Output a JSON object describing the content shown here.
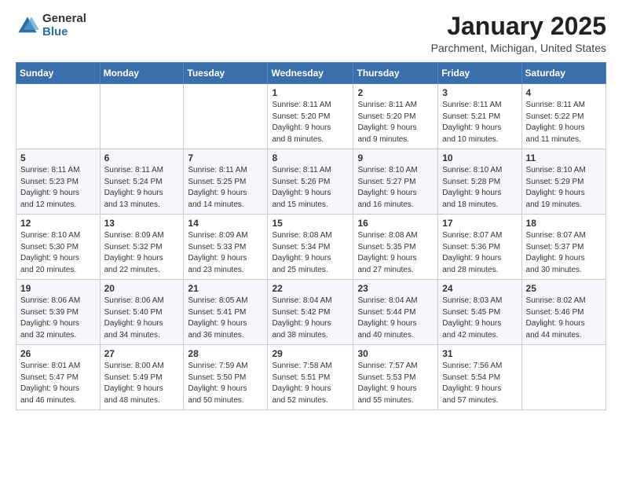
{
  "header": {
    "logo_general": "General",
    "logo_blue": "Blue",
    "month_title": "January 2025",
    "location": "Parchment, Michigan, United States"
  },
  "days_of_week": [
    "Sunday",
    "Monday",
    "Tuesday",
    "Wednesday",
    "Thursday",
    "Friday",
    "Saturday"
  ],
  "weeks": [
    [
      {
        "day": "",
        "info": ""
      },
      {
        "day": "",
        "info": ""
      },
      {
        "day": "",
        "info": ""
      },
      {
        "day": "1",
        "info": "Sunrise: 8:11 AM\nSunset: 5:20 PM\nDaylight: 9 hours\nand 8 minutes."
      },
      {
        "day": "2",
        "info": "Sunrise: 8:11 AM\nSunset: 5:20 PM\nDaylight: 9 hours\nand 9 minutes."
      },
      {
        "day": "3",
        "info": "Sunrise: 8:11 AM\nSunset: 5:21 PM\nDaylight: 9 hours\nand 10 minutes."
      },
      {
        "day": "4",
        "info": "Sunrise: 8:11 AM\nSunset: 5:22 PM\nDaylight: 9 hours\nand 11 minutes."
      }
    ],
    [
      {
        "day": "5",
        "info": "Sunrise: 8:11 AM\nSunset: 5:23 PM\nDaylight: 9 hours\nand 12 minutes."
      },
      {
        "day": "6",
        "info": "Sunrise: 8:11 AM\nSunset: 5:24 PM\nDaylight: 9 hours\nand 13 minutes."
      },
      {
        "day": "7",
        "info": "Sunrise: 8:11 AM\nSunset: 5:25 PM\nDaylight: 9 hours\nand 14 minutes."
      },
      {
        "day": "8",
        "info": "Sunrise: 8:11 AM\nSunset: 5:26 PM\nDaylight: 9 hours\nand 15 minutes."
      },
      {
        "day": "9",
        "info": "Sunrise: 8:10 AM\nSunset: 5:27 PM\nDaylight: 9 hours\nand 16 minutes."
      },
      {
        "day": "10",
        "info": "Sunrise: 8:10 AM\nSunset: 5:28 PM\nDaylight: 9 hours\nand 18 minutes."
      },
      {
        "day": "11",
        "info": "Sunrise: 8:10 AM\nSunset: 5:29 PM\nDaylight: 9 hours\nand 19 minutes."
      }
    ],
    [
      {
        "day": "12",
        "info": "Sunrise: 8:10 AM\nSunset: 5:30 PM\nDaylight: 9 hours\nand 20 minutes."
      },
      {
        "day": "13",
        "info": "Sunrise: 8:09 AM\nSunset: 5:32 PM\nDaylight: 9 hours\nand 22 minutes."
      },
      {
        "day": "14",
        "info": "Sunrise: 8:09 AM\nSunset: 5:33 PM\nDaylight: 9 hours\nand 23 minutes."
      },
      {
        "day": "15",
        "info": "Sunrise: 8:08 AM\nSunset: 5:34 PM\nDaylight: 9 hours\nand 25 minutes."
      },
      {
        "day": "16",
        "info": "Sunrise: 8:08 AM\nSunset: 5:35 PM\nDaylight: 9 hours\nand 27 minutes."
      },
      {
        "day": "17",
        "info": "Sunrise: 8:07 AM\nSunset: 5:36 PM\nDaylight: 9 hours\nand 28 minutes."
      },
      {
        "day": "18",
        "info": "Sunrise: 8:07 AM\nSunset: 5:37 PM\nDaylight: 9 hours\nand 30 minutes."
      }
    ],
    [
      {
        "day": "19",
        "info": "Sunrise: 8:06 AM\nSunset: 5:39 PM\nDaylight: 9 hours\nand 32 minutes."
      },
      {
        "day": "20",
        "info": "Sunrise: 8:06 AM\nSunset: 5:40 PM\nDaylight: 9 hours\nand 34 minutes."
      },
      {
        "day": "21",
        "info": "Sunrise: 8:05 AM\nSunset: 5:41 PM\nDaylight: 9 hours\nand 36 minutes."
      },
      {
        "day": "22",
        "info": "Sunrise: 8:04 AM\nSunset: 5:42 PM\nDaylight: 9 hours\nand 38 minutes."
      },
      {
        "day": "23",
        "info": "Sunrise: 8:04 AM\nSunset: 5:44 PM\nDaylight: 9 hours\nand 40 minutes."
      },
      {
        "day": "24",
        "info": "Sunrise: 8:03 AM\nSunset: 5:45 PM\nDaylight: 9 hours\nand 42 minutes."
      },
      {
        "day": "25",
        "info": "Sunrise: 8:02 AM\nSunset: 5:46 PM\nDaylight: 9 hours\nand 44 minutes."
      }
    ],
    [
      {
        "day": "26",
        "info": "Sunrise: 8:01 AM\nSunset: 5:47 PM\nDaylight: 9 hours\nand 46 minutes."
      },
      {
        "day": "27",
        "info": "Sunrise: 8:00 AM\nSunset: 5:49 PM\nDaylight: 9 hours\nand 48 minutes."
      },
      {
        "day": "28",
        "info": "Sunrise: 7:59 AM\nSunset: 5:50 PM\nDaylight: 9 hours\nand 50 minutes."
      },
      {
        "day": "29",
        "info": "Sunrise: 7:58 AM\nSunset: 5:51 PM\nDaylight: 9 hours\nand 52 minutes."
      },
      {
        "day": "30",
        "info": "Sunrise: 7:57 AM\nSunset: 5:53 PM\nDaylight: 9 hours\nand 55 minutes."
      },
      {
        "day": "31",
        "info": "Sunrise: 7:56 AM\nSunset: 5:54 PM\nDaylight: 9 hours\nand 57 minutes."
      },
      {
        "day": "",
        "info": ""
      }
    ]
  ]
}
